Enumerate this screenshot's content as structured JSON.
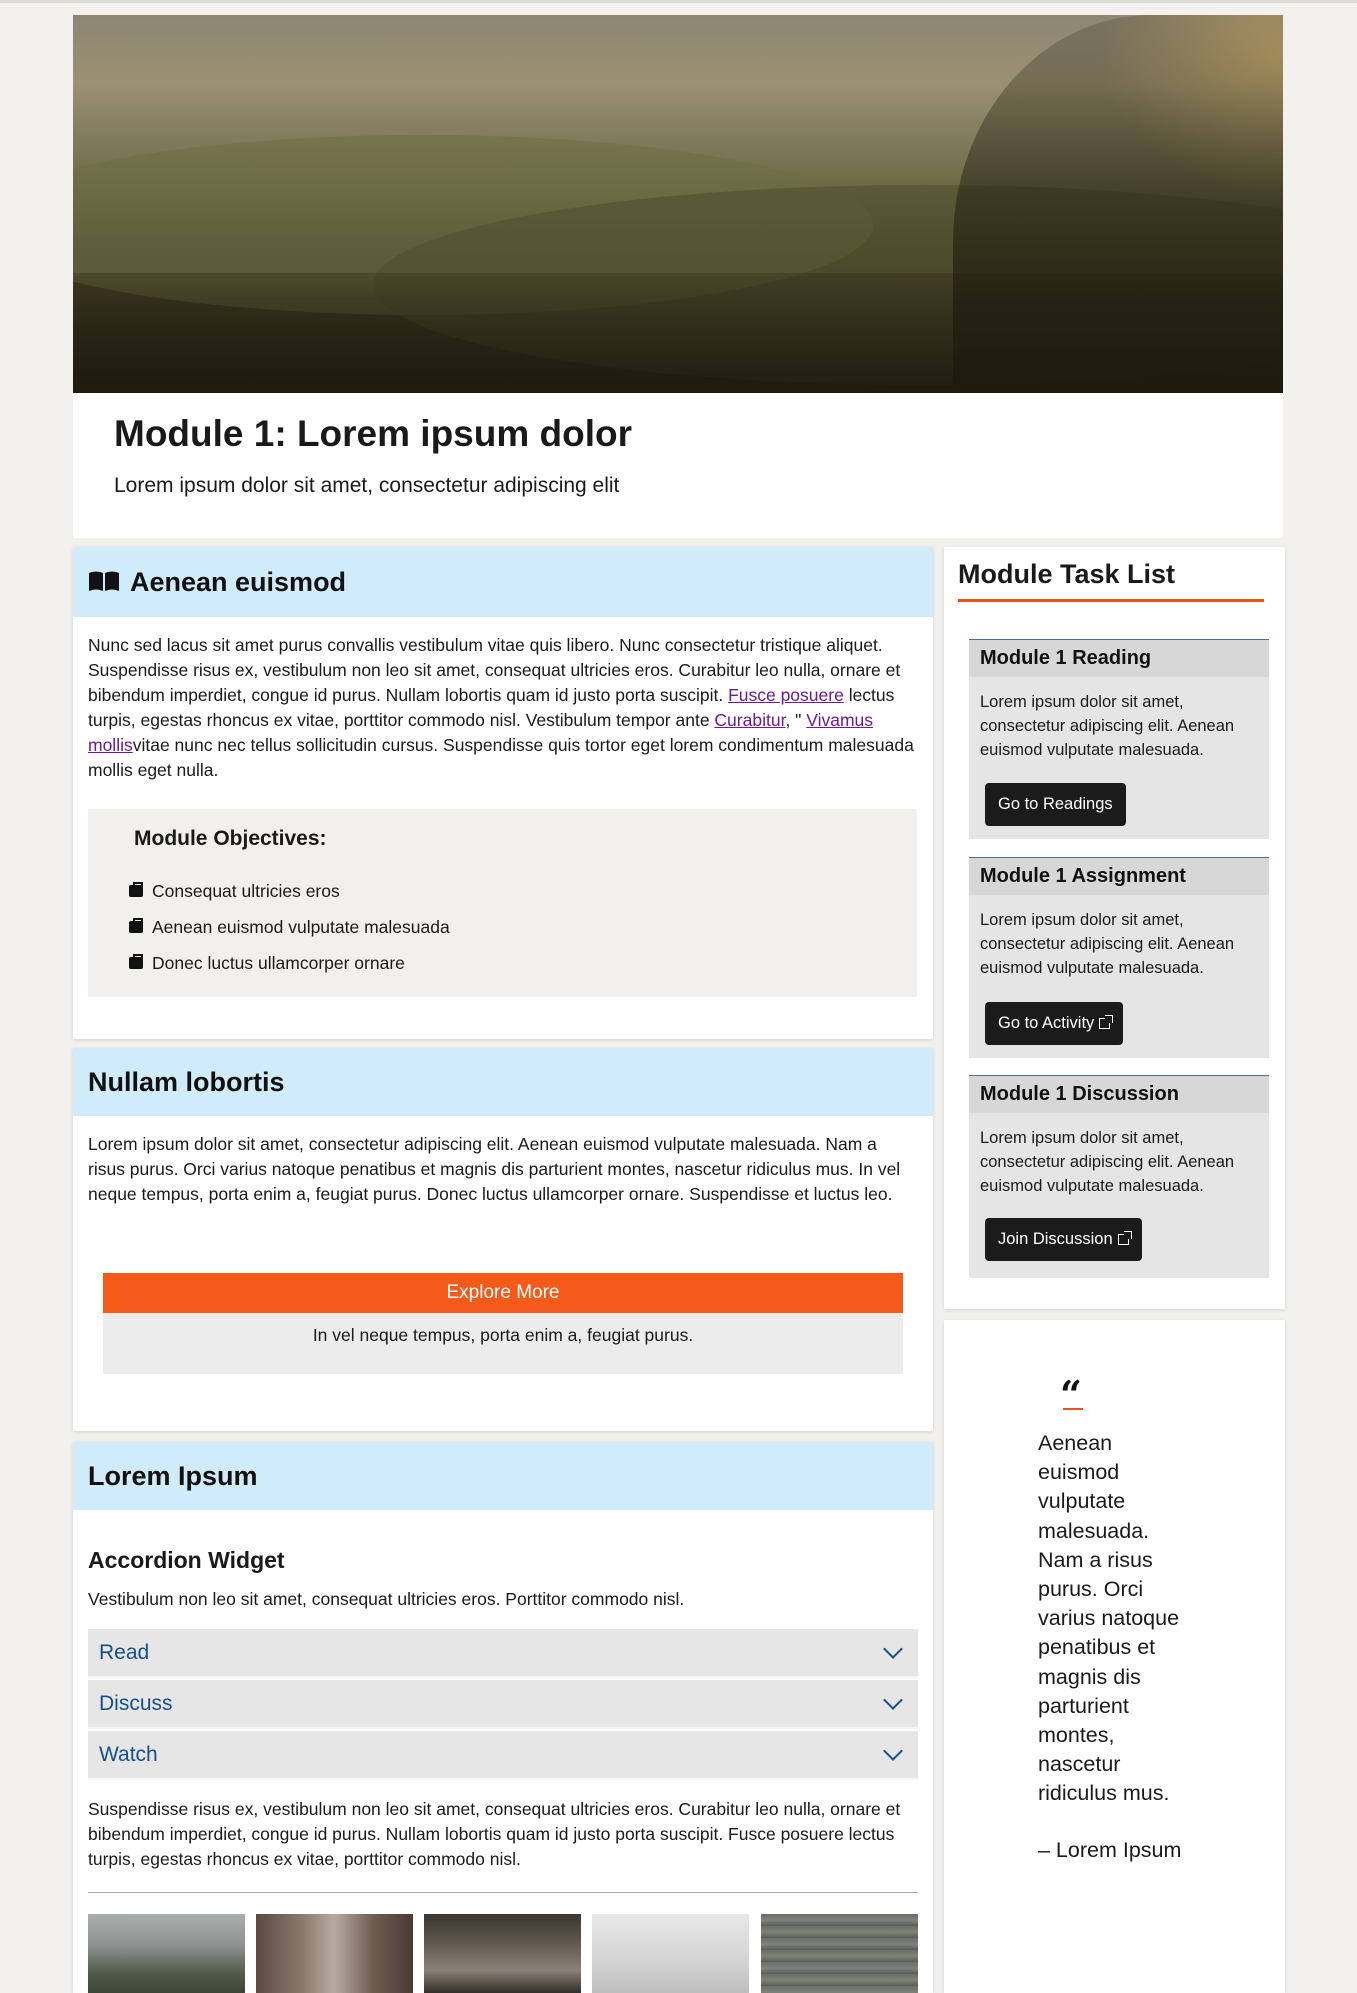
{
  "header": {
    "title": "Module 1: Lorem ipsum dolor",
    "subtitle": "Lorem ipsum dolor sit amet, consectetur adipiscing elit"
  },
  "section1": {
    "title": "Aenean euismod",
    "icon": "book-open-icon",
    "para_part1": "Nunc sed lacus sit amet purus convallis vestibulum vitae quis libero. Nunc consectetur tristique aliquet. Suspendisse risus ex, vestibulum non leo sit amet, consequat ultricies eros. Curabitur leo nulla, ornare et bibendum imperdiet, congue id purus. Nullam lobortis quam id justo porta suscipit. ",
    "link1": "Fusce posuere",
    "para_part2": " lectus turpis, egestas rhoncus ex vitae, porttitor commodo nisl. Vestibulum tempor ante ",
    "link2": "Curabitur",
    "para_part3": ", \" ",
    "link3": "Vivamus mollis",
    "para_part4": "vitae nunc nec tellus sollicitudin cursus. Suspendisse quis tortor eget lorem condimentum malesuada mollis eget nulla.",
    "objectives_title": "Module Objectives:",
    "objectives": [
      "Consequat ultricies eros",
      "Aenean euismod vulputate malesuada",
      "Donec luctus ullamcorper ornare"
    ]
  },
  "section2": {
    "title": "Nullam lobortis",
    "para": "Lorem ipsum dolor sit amet, consectetur adipiscing elit. Aenean euismod vulputate malesuada. Nam a risus purus. Orci varius natoque penatibus et magnis dis parturient montes, nascetur ridiculus mus. In vel neque tempus, porta enim a, feugiat purus. Donec luctus ullamcorper ornare. Suspendisse et luctus leo.",
    "explore_label": "Explore More",
    "explore_text": "In vel neque tempus, porta enim a, feugiat purus."
  },
  "section3": {
    "title": "Lorem Ipsum",
    "widget_title": "Accordion Widget",
    "widget_desc": "Vestibulum non leo sit amet, consequat ultricies eros. Porttitor commodo nisl.",
    "accordion": [
      "Read",
      "Discuss",
      "Watch"
    ],
    "para": "Suspendisse risus ex, vestibulum non leo sit amet, consequat ultricies eros. Curabitur leo nulla, ornare et bibendum imperdiet, congue id purus. Nullam lobortis quam id justo porta suscipit. Fusce posuere lectus turpis, egestas rhoncus ex vitae, porttitor commodo nisl."
  },
  "tasks": {
    "title": "Module Task List",
    "items": [
      {
        "title": "Module 1 Reading",
        "text": "Lorem ipsum dolor sit amet, consectetur adipiscing elit. Aenean euismod vulputate malesuada.",
        "button": "Go to Readings",
        "external": false
      },
      {
        "title": "Module 1 Assignment",
        "text": "Lorem ipsum dolor sit amet, consectetur adipiscing elit. Aenean euismod vulputate malesuada.",
        "button": "Go to Activity",
        "external": true
      },
      {
        "title": "Module 1 Discussion",
        "text": "Lorem ipsum dolor sit amet, consectetur adipiscing elit. Aenean euismod vulputate malesuada.",
        "button": "Join Discussion",
        "external": true
      }
    ]
  },
  "quote": {
    "mark": "“",
    "text": "Aenean euismod vulputate malesuada. Nam a risus purus. Orci varius natoque penatibus et magnis dis parturient montes, nascetur ridiculus mus.",
    "author": "– Lorem Ipsum"
  },
  "colors": {
    "accent": "#f45a1a",
    "card_header": "#d0ebfa",
    "link": "#6a1b9a",
    "accordion_text": "#15508c"
  }
}
